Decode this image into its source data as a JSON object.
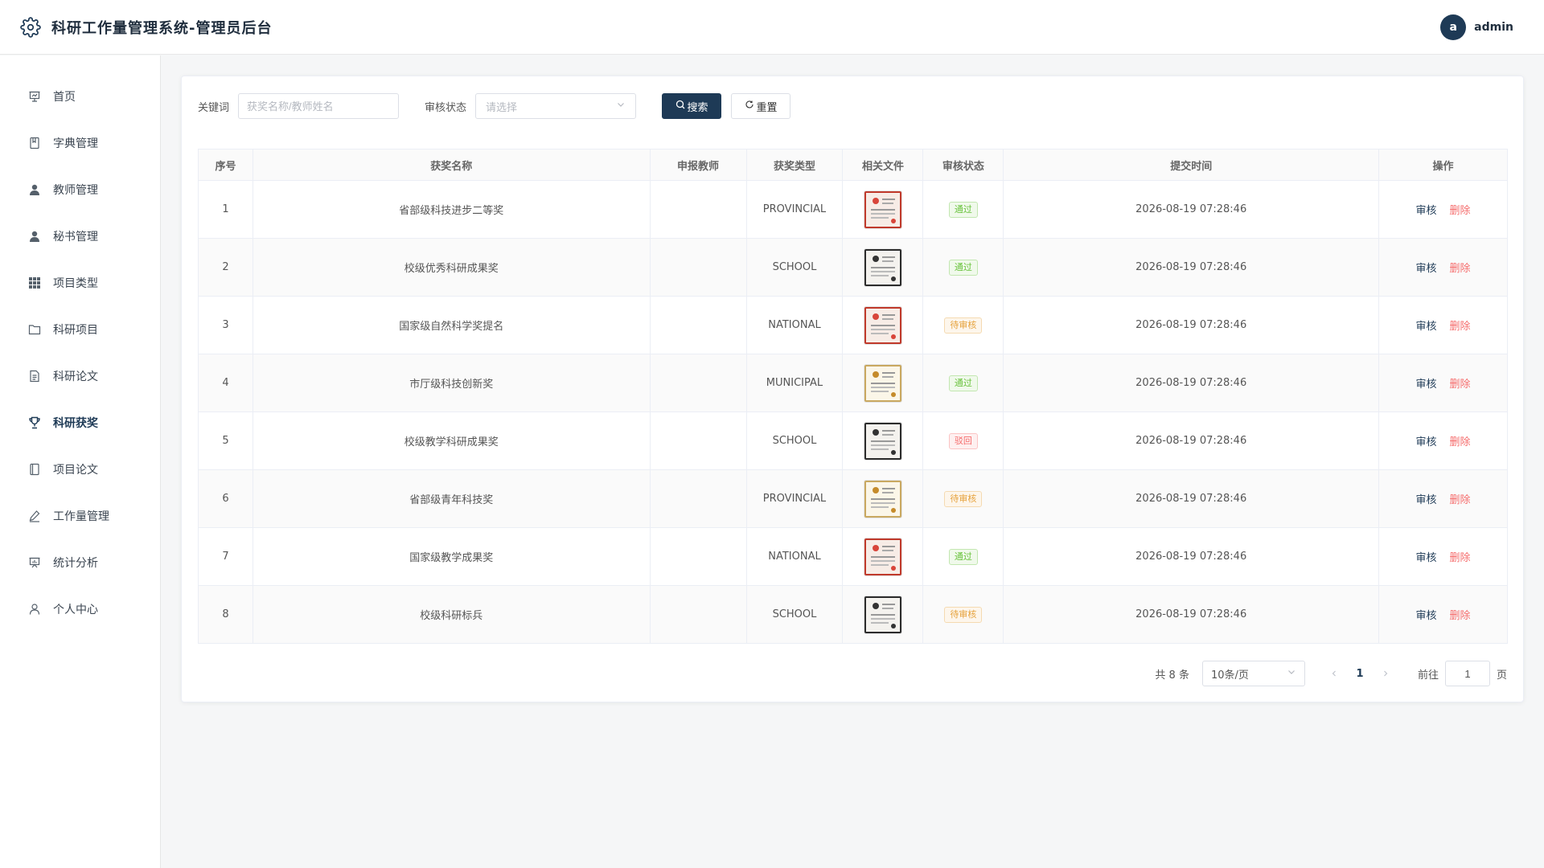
{
  "header": {
    "title": "科研工作量管理系统-管理员后台",
    "avatar_letter": "a",
    "username": "admin"
  },
  "sidebar": {
    "items": [
      {
        "label": "首页",
        "icon": "presentation-icon",
        "active": false
      },
      {
        "label": "字典管理",
        "icon": "book-icon",
        "active": false
      },
      {
        "label": "教师管理",
        "icon": "user-filled-icon",
        "active": false
      },
      {
        "label": "秘书管理",
        "icon": "user-filled-icon",
        "active": false
      },
      {
        "label": "项目类型",
        "icon": "grid-icon",
        "active": false
      },
      {
        "label": "科研项目",
        "icon": "folder-icon",
        "active": false
      },
      {
        "label": "科研论文",
        "icon": "document-icon",
        "active": false
      },
      {
        "label": "科研获奖",
        "icon": "trophy-icon",
        "active": true
      },
      {
        "label": "项目论文",
        "icon": "notebook-icon",
        "active": false
      },
      {
        "label": "工作量管理",
        "icon": "edit-pen-icon",
        "active": false
      },
      {
        "label": "统计分析",
        "icon": "chart-board-icon",
        "active": false
      },
      {
        "label": "个人中心",
        "icon": "user-outline-icon",
        "active": false
      }
    ]
  },
  "filters": {
    "keyword_label": "关键词",
    "keyword_placeholder": "获奖名称/教师姓名",
    "keyword_value": "",
    "status_label": "审核状态",
    "status_placeholder": "请选择",
    "search_label": "搜索",
    "reset_label": "重置"
  },
  "table": {
    "columns": [
      "序号",
      "获奖名称",
      "申报教师",
      "获奖类型",
      "相关文件",
      "审核状态",
      "提交时间",
      "操作"
    ],
    "audit_label": "审核",
    "delete_label": "删除",
    "rows": [
      {
        "index": "1",
        "name": "省部级科技进步二等奖",
        "teacher": "",
        "type": "PROVINCIAL",
        "thumb": "red",
        "status": "通过",
        "status_kind": "pass",
        "time": "2026-08-19 07:28:46"
      },
      {
        "index": "2",
        "name": "校级优秀科研成果奖",
        "teacher": "",
        "type": "SCHOOL",
        "thumb": "dark",
        "status": "通过",
        "status_kind": "pass",
        "time": "2026-08-19 07:28:46"
      },
      {
        "index": "3",
        "name": "国家级自然科学奖提名",
        "teacher": "",
        "type": "NATIONAL",
        "thumb": "red",
        "status": "待审核",
        "status_kind": "wait",
        "time": "2026-08-19 07:28:46"
      },
      {
        "index": "4",
        "name": "市厅级科技创新奖",
        "teacher": "",
        "type": "MUNICIPAL",
        "thumb": "gold",
        "status": "通过",
        "status_kind": "pass",
        "time": "2026-08-19 07:28:46"
      },
      {
        "index": "5",
        "name": "校级教学科研成果奖",
        "teacher": "",
        "type": "SCHOOL",
        "thumb": "dark",
        "status": "驳回",
        "status_kind": "reject",
        "time": "2026-08-19 07:28:46"
      },
      {
        "index": "6",
        "name": "省部级青年科技奖",
        "teacher": "",
        "type": "PROVINCIAL",
        "thumb": "gold",
        "status": "待审核",
        "status_kind": "wait",
        "time": "2026-08-19 07:28:46"
      },
      {
        "index": "7",
        "name": "国家级教学成果奖",
        "teacher": "",
        "type": "NATIONAL",
        "thumb": "red",
        "status": "通过",
        "status_kind": "pass",
        "time": "2026-08-19 07:28:46"
      },
      {
        "index": "8",
        "name": "校级科研标兵",
        "teacher": "",
        "type": "SCHOOL",
        "thumb": "dark",
        "status": "待审核",
        "status_kind": "wait",
        "time": "2026-08-19 07:28:46"
      }
    ]
  },
  "pagination": {
    "total_text": "共 8 条",
    "page_size": "10条/页",
    "current_page": "1",
    "goto_label": "前往",
    "goto_value": "1",
    "page_suffix": "页"
  },
  "colors": {
    "primary": "#1e3a56",
    "pass": "#67c23a",
    "wait": "#e6a23c",
    "reject": "#f56c6c"
  }
}
